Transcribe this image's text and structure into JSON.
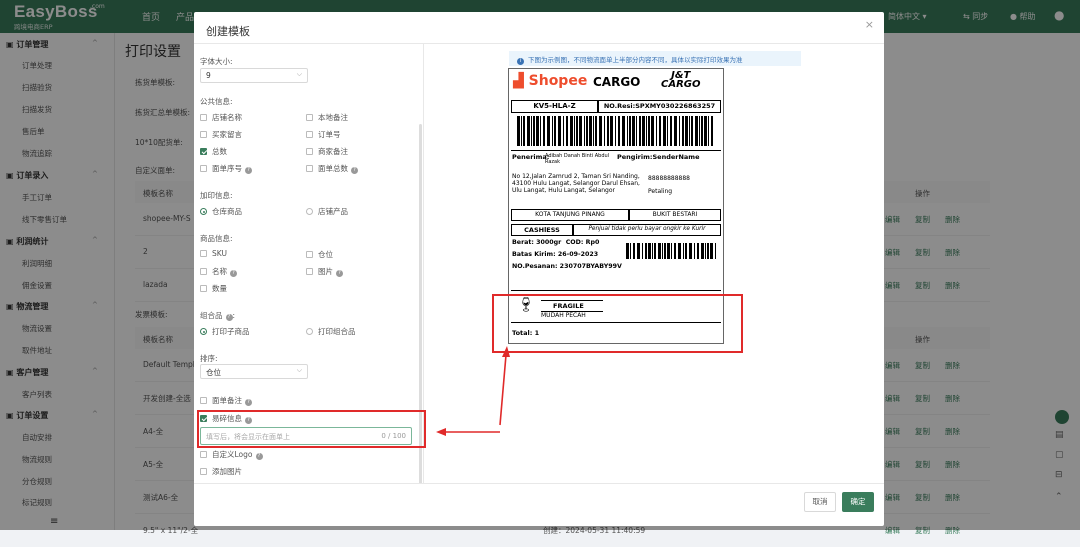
{
  "topbar": {
    "logo": "EasyBoss",
    "logo_com": ".com",
    "logo_sub": "跨境电商ERP",
    "nav": [
      "首页",
      "产品"
    ],
    "language": "简体中文",
    "sync": "同步",
    "help": "帮助"
  },
  "sidebar": {
    "groups": [
      {
        "label": "订单管理",
        "items": [
          "订单处理",
          "扫描验货",
          "扫描发货",
          "售后单",
          "物流追踪"
        ]
      },
      {
        "label": "订单录入",
        "items": [
          "手工订单",
          "线下零售订单"
        ]
      },
      {
        "label": "利润统计",
        "items": [
          "利润明细",
          "佣金设置"
        ]
      },
      {
        "label": "物流管理",
        "items": [
          "物流设置",
          "取件地址"
        ]
      },
      {
        "label": "客户管理",
        "items": [
          "客户列表"
        ]
      },
      {
        "label": "订单设置",
        "items": [
          "自动安排",
          "物流规则",
          "分仓规则",
          "标记规则"
        ]
      }
    ]
  },
  "background": {
    "page_title": "打印设置",
    "labels": [
      "拣货单模板:",
      "拣货汇总单模板:",
      "10*10配货单:",
      "自定义面单:"
    ],
    "table1_header": "模板名称",
    "table1_rows": [
      "shopee-MY-S",
      "2",
      "lazada"
    ],
    "invoice_label": "发票模板:",
    "table2_header": "模板名称",
    "table2_rows": [
      "Default Templ",
      "开发创建-全选",
      "A4-全",
      "A5-全",
      "测试A6-全",
      "9.5\" x 11\"/2-全"
    ],
    "actions": [
      "编辑",
      "复制",
      "删除"
    ],
    "ops_header": "操作",
    "created_text": "创建：2024-05-31 11:40:59"
  },
  "modal": {
    "title": "创建模板",
    "close": "×",
    "font_size_label": "字体大小:",
    "font_size_value": "9",
    "public_info_label": "公共信息:",
    "public_info": [
      {
        "label": "店铺名称",
        "checked": false
      },
      {
        "label": "本地备注",
        "checked": false
      },
      {
        "label": "买家留言",
        "checked": false
      },
      {
        "label": "订单号",
        "checked": false
      },
      {
        "label": "总数",
        "checked": true
      },
      {
        "label": "商家备注",
        "checked": false
      },
      {
        "label": "面单序号",
        "checked": false
      },
      {
        "label": "面单总数",
        "checked": false
      }
    ],
    "add_info_label": "加印信息:",
    "add_info": [
      "仓库商品",
      "店铺产品"
    ],
    "product_info_label": "商品信息:",
    "product_info": [
      {
        "label": "SKU",
        "checked": false
      },
      {
        "label": "仓位",
        "checked": false
      },
      {
        "label": "名称",
        "checked": false
      },
      {
        "label": "图片",
        "checked": false
      },
      {
        "label": "数量",
        "checked": false
      }
    ],
    "combo_label": "组合品",
    "combo": [
      "打印子商品",
      "打印组合品"
    ],
    "sort_label": "排序:",
    "sort_value": "仓位",
    "order_remark": "面单备注",
    "fragile_info": "易碎信息",
    "fragile_placeholder": "填写后，将会显示在面单上",
    "fragile_count": "0 / 100",
    "custom_logo": "自定义Logo",
    "add_image": "添加图片",
    "cancel": "取消",
    "confirm": "确定"
  },
  "preview": {
    "notice": "下图为示例图，不同物流面单上半部分内容不同，具体以实际打印效果为准",
    "shopee": "Shopee",
    "cargo": "CARGO",
    "jt_line1": "J&T",
    "jt_line2": "CARGO",
    "route_code": "KV5-HLA-Z",
    "resi": "NO.Resi:SPXMY030226863257",
    "penerima_label": "Penerima:",
    "penerima_name": "Adibah Danah Binti Abdul Razak",
    "pengirim_label": "Pengirim:",
    "pengirim_name": "SenderName",
    "address": "No 12,Jalan Zamrud 2, Taman Sri Nanding, 43100 Hulu Langat, Selangor Darul Ehsan, Ulu Langat, Hulu Langat, Selangor",
    "sender_phone": "88888888888",
    "sender_city": "Petaling",
    "dest_city": "KOTA TANJUNG PINANG",
    "origin_city": "BUKIT BESTARI",
    "cashless": "CASHlESS",
    "free_note": "Penjual tidak perlu bayar ongkir ke Kurir",
    "berat": "Berat: 3000gr",
    "cod": "COD: Rp0",
    "batas": "Batas Kirim: 26-09-2023",
    "pesanan": "NO.Pesanan: 230707BYABY99V",
    "fragile": "FRAGILE",
    "mudah": "MUDAH PECAH",
    "total": "Total: 1"
  },
  "colors": {
    "brand": "#3a7d5c",
    "shopee": "#ee4d2d",
    "annotation": "#e02a2a",
    "link": "#3a73b5"
  }
}
